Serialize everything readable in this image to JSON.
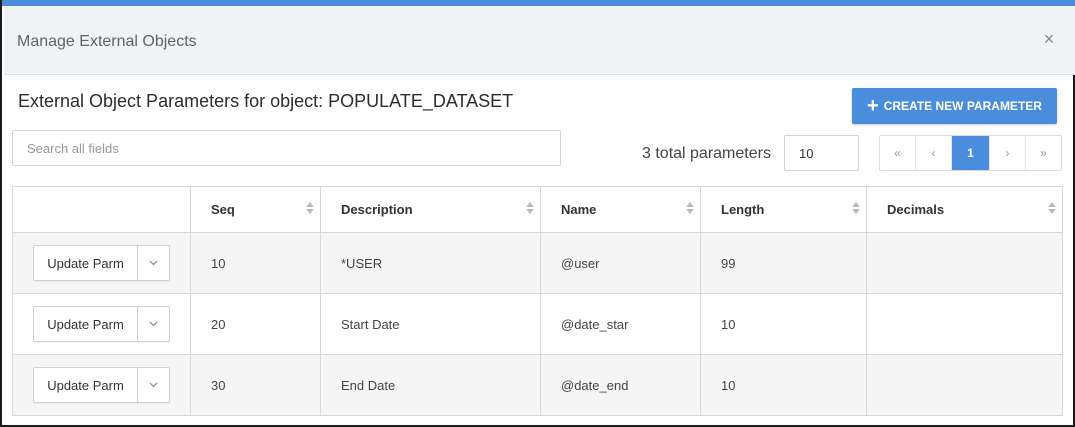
{
  "modal": {
    "title": "Manage External Objects",
    "close_glyph": "×"
  },
  "subtitle": "External Object Parameters for object: POPULATE_DATASET",
  "create_button": {
    "icon": "plus-icon",
    "label": "CREATE NEW PARAMETER"
  },
  "search": {
    "placeholder": "Search all fields",
    "value": ""
  },
  "total_text": "3 total parameters",
  "page_size": "10",
  "pager": {
    "first": "«",
    "prev": "‹",
    "current": "1",
    "next": "›",
    "last": "»"
  },
  "table": {
    "headers": [
      "",
      "Seq",
      "Description",
      "Name",
      "Length",
      "Decimals"
    ],
    "action_label": "Update Parm",
    "rows": [
      {
        "seq": "10",
        "description": "*USER",
        "name": "@user",
        "length": "99",
        "decimals": ""
      },
      {
        "seq": "20",
        "description": "Start Date",
        "name": "@date_star",
        "length": "10",
        "decimals": ""
      },
      {
        "seq": "30",
        "description": "End Date",
        "name": "@date_end",
        "length": "10",
        "decimals": ""
      }
    ]
  },
  "colors": {
    "accent": "#4a8ddc",
    "header_bg": "#f1f4f7"
  }
}
